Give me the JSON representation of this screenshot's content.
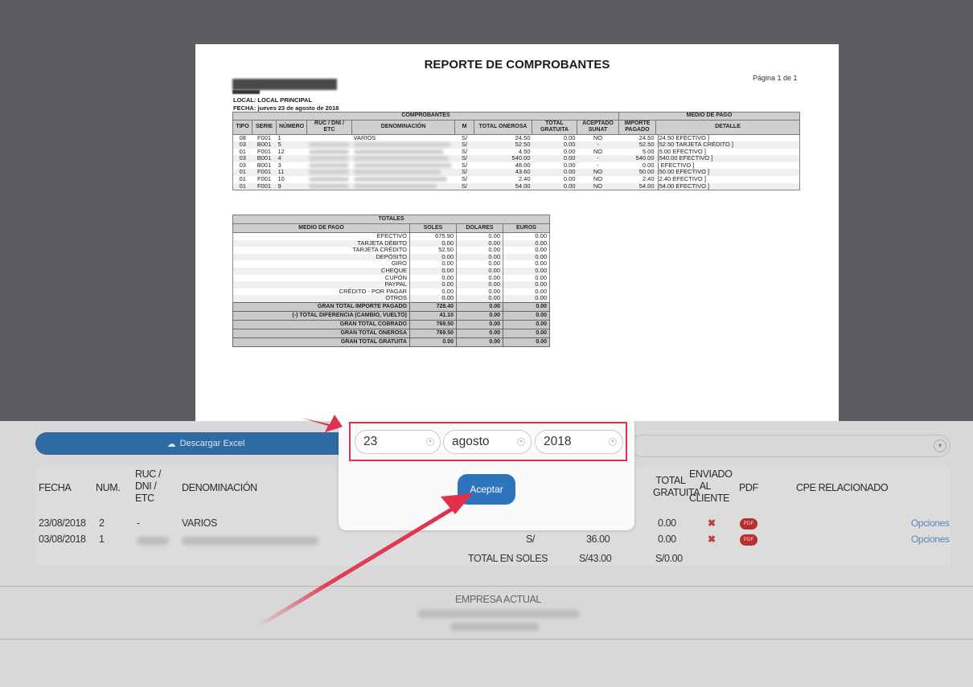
{
  "report": {
    "title": "REPORTE DE COMPROBANTES",
    "page": "Página 1 de 1",
    "local": "LOCAL: LOCAL PRINCIPAL",
    "fecha": "FECHA: jueves 23 de agosto de 2018",
    "group_headers": {
      "comprobantes": "COMPROBANTES",
      "medio_pago": "MEDIO DE PAGO"
    },
    "columns": {
      "tipo": "TIPO",
      "serie": "SERIE",
      "numero": "NÚMERO",
      "ruc": "RUC / DNI / ETC",
      "denominacion": "DENOMINACIÓN",
      "m": "M",
      "total_onerosa": "TOTAL ONEROSA",
      "total_gratuita": "TOTAL GRATUITA",
      "aceptado": "ACEPTADO SUNAT",
      "importe": "IMPORTE PAGADO",
      "detalle": "DETALLE"
    },
    "rows": [
      {
        "tipo": "08",
        "serie": "F001",
        "numero": "1",
        "denominacion": "VARIOS",
        "m": "S/",
        "onerosa": "24.50",
        "gratuita": "0.00",
        "aceptado": "NO",
        "importe": "24.50",
        "detalle": "[24.50 EFECTIVO ]"
      },
      {
        "tipo": "03",
        "serie": "B001",
        "numero": "5",
        "denominacion": "",
        "m": "S/",
        "onerosa": "52.50",
        "gratuita": "0.00",
        "aceptado": "-",
        "importe": "52.50",
        "detalle": "[52.50 TARJETA CRÉDITO ]"
      },
      {
        "tipo": "01",
        "serie": "F001",
        "numero": "12",
        "denominacion": "",
        "m": "S/",
        "onerosa": "4.50",
        "gratuita": "0.00",
        "aceptado": "NO",
        "importe": "5.00",
        "detalle": "[5.00 EFECTIVO ]"
      },
      {
        "tipo": "03",
        "serie": "B001",
        "numero": "4",
        "denominacion": "",
        "m": "S/",
        "onerosa": "540.00",
        "gratuita": "0.00",
        "aceptado": "-",
        "importe": "540.00",
        "detalle": "[540.00 EFECTIVO ]"
      },
      {
        "tipo": "03",
        "serie": "B001",
        "numero": "3",
        "denominacion": "",
        "m": "S/",
        "onerosa": "48.00",
        "gratuita": "0.00",
        "aceptado": "-",
        "importe": "0.00",
        "detalle": "[ EFECTIVO ]"
      },
      {
        "tipo": "01",
        "serie": "F001",
        "numero": "11",
        "denominacion": "",
        "m": "S/",
        "onerosa": "43.60",
        "gratuita": "0.00",
        "aceptado": "NO",
        "importe": "50.00",
        "detalle": "[50.00 EFECTIVO ]"
      },
      {
        "tipo": "01",
        "serie": "F001",
        "numero": "10",
        "denominacion": "",
        "m": "S/",
        "onerosa": "2.40",
        "gratuita": "0.00",
        "aceptado": "NO",
        "importe": "2.40",
        "detalle": "[2.40 EFECTIVO ]"
      },
      {
        "tipo": "01",
        "serie": "F001",
        "numero": "9",
        "denominacion": "",
        "m": "S/",
        "onerosa": "54.00",
        "gratuita": "0.00",
        "aceptado": "NO",
        "importe": "54.00",
        "detalle": "[54.00 EFECTIVO ]"
      }
    ],
    "totales": {
      "title": "TOTALES",
      "headers": {
        "medio": "MEDIO DE PAGO",
        "soles": "SOLES",
        "dolares": "DOLARES",
        "euros": "EUROS"
      },
      "rows": [
        {
          "medio": "EFECTIVO",
          "soles": "675.90",
          "dolares": "0.00",
          "euros": "0.00"
        },
        {
          "medio": "TARJETA DÉBITO",
          "soles": "0.00",
          "dolares": "0.00",
          "euros": "0.00"
        },
        {
          "medio": "TARJETA CRÉDITO",
          "soles": "52.50",
          "dolares": "0.00",
          "euros": "0.00"
        },
        {
          "medio": "DEPÓSITO",
          "soles": "0.00",
          "dolares": "0.00",
          "euros": "0.00"
        },
        {
          "medio": "GIRO",
          "soles": "0.00",
          "dolares": "0.00",
          "euros": "0.00"
        },
        {
          "medio": "CHEQUE",
          "soles": "0.00",
          "dolares": "0.00",
          "euros": "0.00"
        },
        {
          "medio": "CUPÓN",
          "soles": "0.00",
          "dolares": "0.00",
          "euros": "0.00"
        },
        {
          "medio": "PAYPAL",
          "soles": "0.00",
          "dolares": "0.00",
          "euros": "0.00"
        },
        {
          "medio": "CRÉDITO - POR PAGAR",
          "soles": "0.00",
          "dolares": "0.00",
          "euros": "0.00"
        },
        {
          "medio": "OTROS",
          "soles": "0.00",
          "dolares": "0.00",
          "euros": "0.00"
        }
      ],
      "grand": [
        {
          "medio": "GRAN TOTAL IMPORTE PAGADO",
          "soles": "728.40",
          "dolares": "0.00",
          "euros": "0.00"
        },
        {
          "medio": "(-) TOTAL DIFERENCIA (CAMBIO, VUELTO)",
          "soles": "41.10",
          "dolares": "0.00",
          "euros": "0.00"
        },
        {
          "medio": "GRAN TOTAL COBRADO",
          "soles": "769.50",
          "dolares": "0.00",
          "euros": "0.00"
        },
        {
          "medio": "GRAN TOTAL ONEROSA",
          "soles": "769.50",
          "dolares": "0.00",
          "euros": "0.00"
        },
        {
          "medio": "GRAN TOTAL GRATUITA",
          "soles": "0.00",
          "dolares": "0.00",
          "euros": "0.00"
        }
      ]
    }
  },
  "modal": {
    "day": "23",
    "month": "agosto",
    "year": "2018",
    "accept_label": "Aceptar"
  },
  "app": {
    "excel_label": "Descargar Excel",
    "headers": {
      "fecha": "FECHA",
      "num": "NUM.",
      "ruc": "RUC /\nDNI /\nETC",
      "denominacion": "DENOMINACIÓN",
      "total_gratuita": "TOTAL\nGRATUITA",
      "enviado": "ENVIADO\nAL\nCLIENTE",
      "pdf": "PDF",
      "cpe": "CPE RELACIONADO"
    },
    "rows": [
      {
        "fecha": "23/08/2018",
        "num": "2",
        "ruc": "-",
        "denominacion": "VARIOS",
        "m": "",
        "total": "",
        "gratuita": "0.00",
        "pdf": "PDF",
        "opciones": "Opciones"
      },
      {
        "fecha": "03/08/2018",
        "num": "1",
        "ruc": "",
        "denominacion": "",
        "m": "S/",
        "total": "36.00",
        "gratuita": "0.00",
        "pdf": "PDF",
        "opciones": "Opciones"
      }
    ],
    "totals": {
      "label": "TOTAL EN SOLES",
      "total": "S/43.00",
      "gratuita": "S/0.00"
    },
    "empresa_label": "EMPRESA ACTUAL"
  },
  "colors": {
    "accent_red": "#d8384a",
    "primary_blue": "#2e74bd",
    "pdf_red": "#b73030",
    "overlay": "#5b5d60"
  }
}
